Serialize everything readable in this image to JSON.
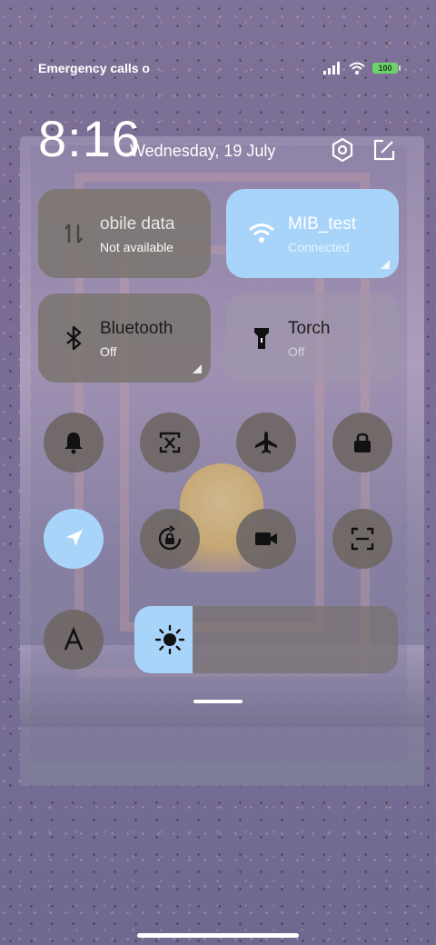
{
  "status_bar": {
    "carrier_text": "Emergency calls o",
    "battery_level": "100",
    "signal_icon": "signal-icon",
    "wifi_icon": "wifi-icon"
  },
  "header": {
    "time": "8:16",
    "date": "Wednesday, 19 July",
    "settings_icon": "settings-icon",
    "edit_icon": "edit-icon"
  },
  "tiles": {
    "mobile_data": {
      "title": "obile data",
      "subtitle": "Not available",
      "icon": "mobile-data-icon"
    },
    "wifi": {
      "title": "MIB_test",
      "subtitle": "Connected",
      "icon": "wifi-icon"
    },
    "bluetooth": {
      "title": "Bluetooth",
      "subtitle": "Off",
      "icon": "bluetooth-icon"
    },
    "torch": {
      "title": "Torch",
      "subtitle": "Off",
      "icon": "torch-icon"
    }
  },
  "toggles": [
    {
      "name": "bell-icon",
      "active": false
    },
    {
      "name": "screenshot-icon",
      "active": false
    },
    {
      "name": "airplane-icon",
      "active": false
    },
    {
      "name": "lock-icon",
      "active": false
    },
    {
      "name": "location-icon",
      "active": true
    },
    {
      "name": "rotation-lock-icon",
      "active": false
    },
    {
      "name": "screen-record-icon",
      "active": false
    },
    {
      "name": "scan-icon",
      "active": false
    },
    {
      "name": "font-size-icon",
      "active": false
    }
  ],
  "brightness": {
    "level": 0.22,
    "icon": "brightness-icon"
  },
  "colors": {
    "active_tile": "#a9d4fa",
    "inactive_tile": "#7d7673"
  }
}
